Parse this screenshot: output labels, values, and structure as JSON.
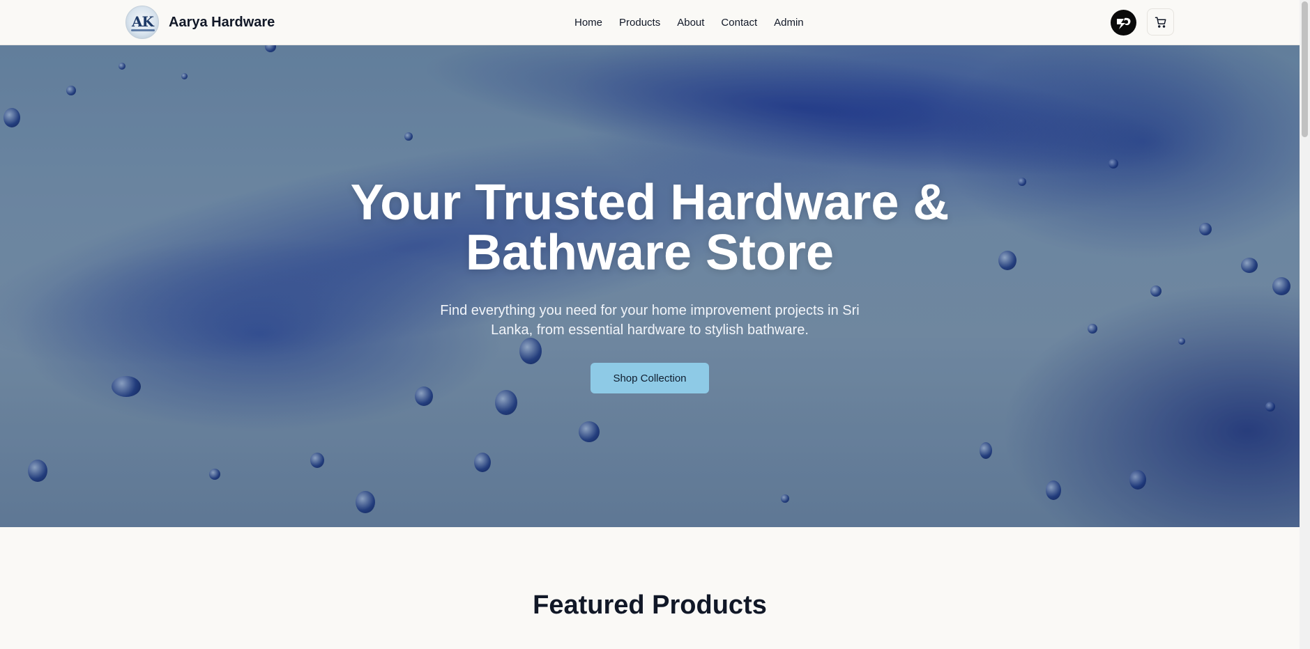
{
  "header": {
    "brand": "Aarya Hardware",
    "logo_text": "AK",
    "nav": [
      {
        "label": "Home"
      },
      {
        "label": "Products"
      },
      {
        "label": "About"
      },
      {
        "label": "Contact"
      },
      {
        "label": "Admin"
      }
    ],
    "avatar_icon": "user-avatar-icon",
    "cart_icon": "cart-icon"
  },
  "hero": {
    "title_line1": "Your Trusted Hardware &",
    "title_line2": "Bathware Store",
    "subtitle": "Find everything you need for your home improvement projects in Sri Lanka, from essential hardware to stylish bathware.",
    "cta_label": "Shop Collection",
    "cta_color": "#8ecae6"
  },
  "featured": {
    "title": "Featured Products"
  }
}
